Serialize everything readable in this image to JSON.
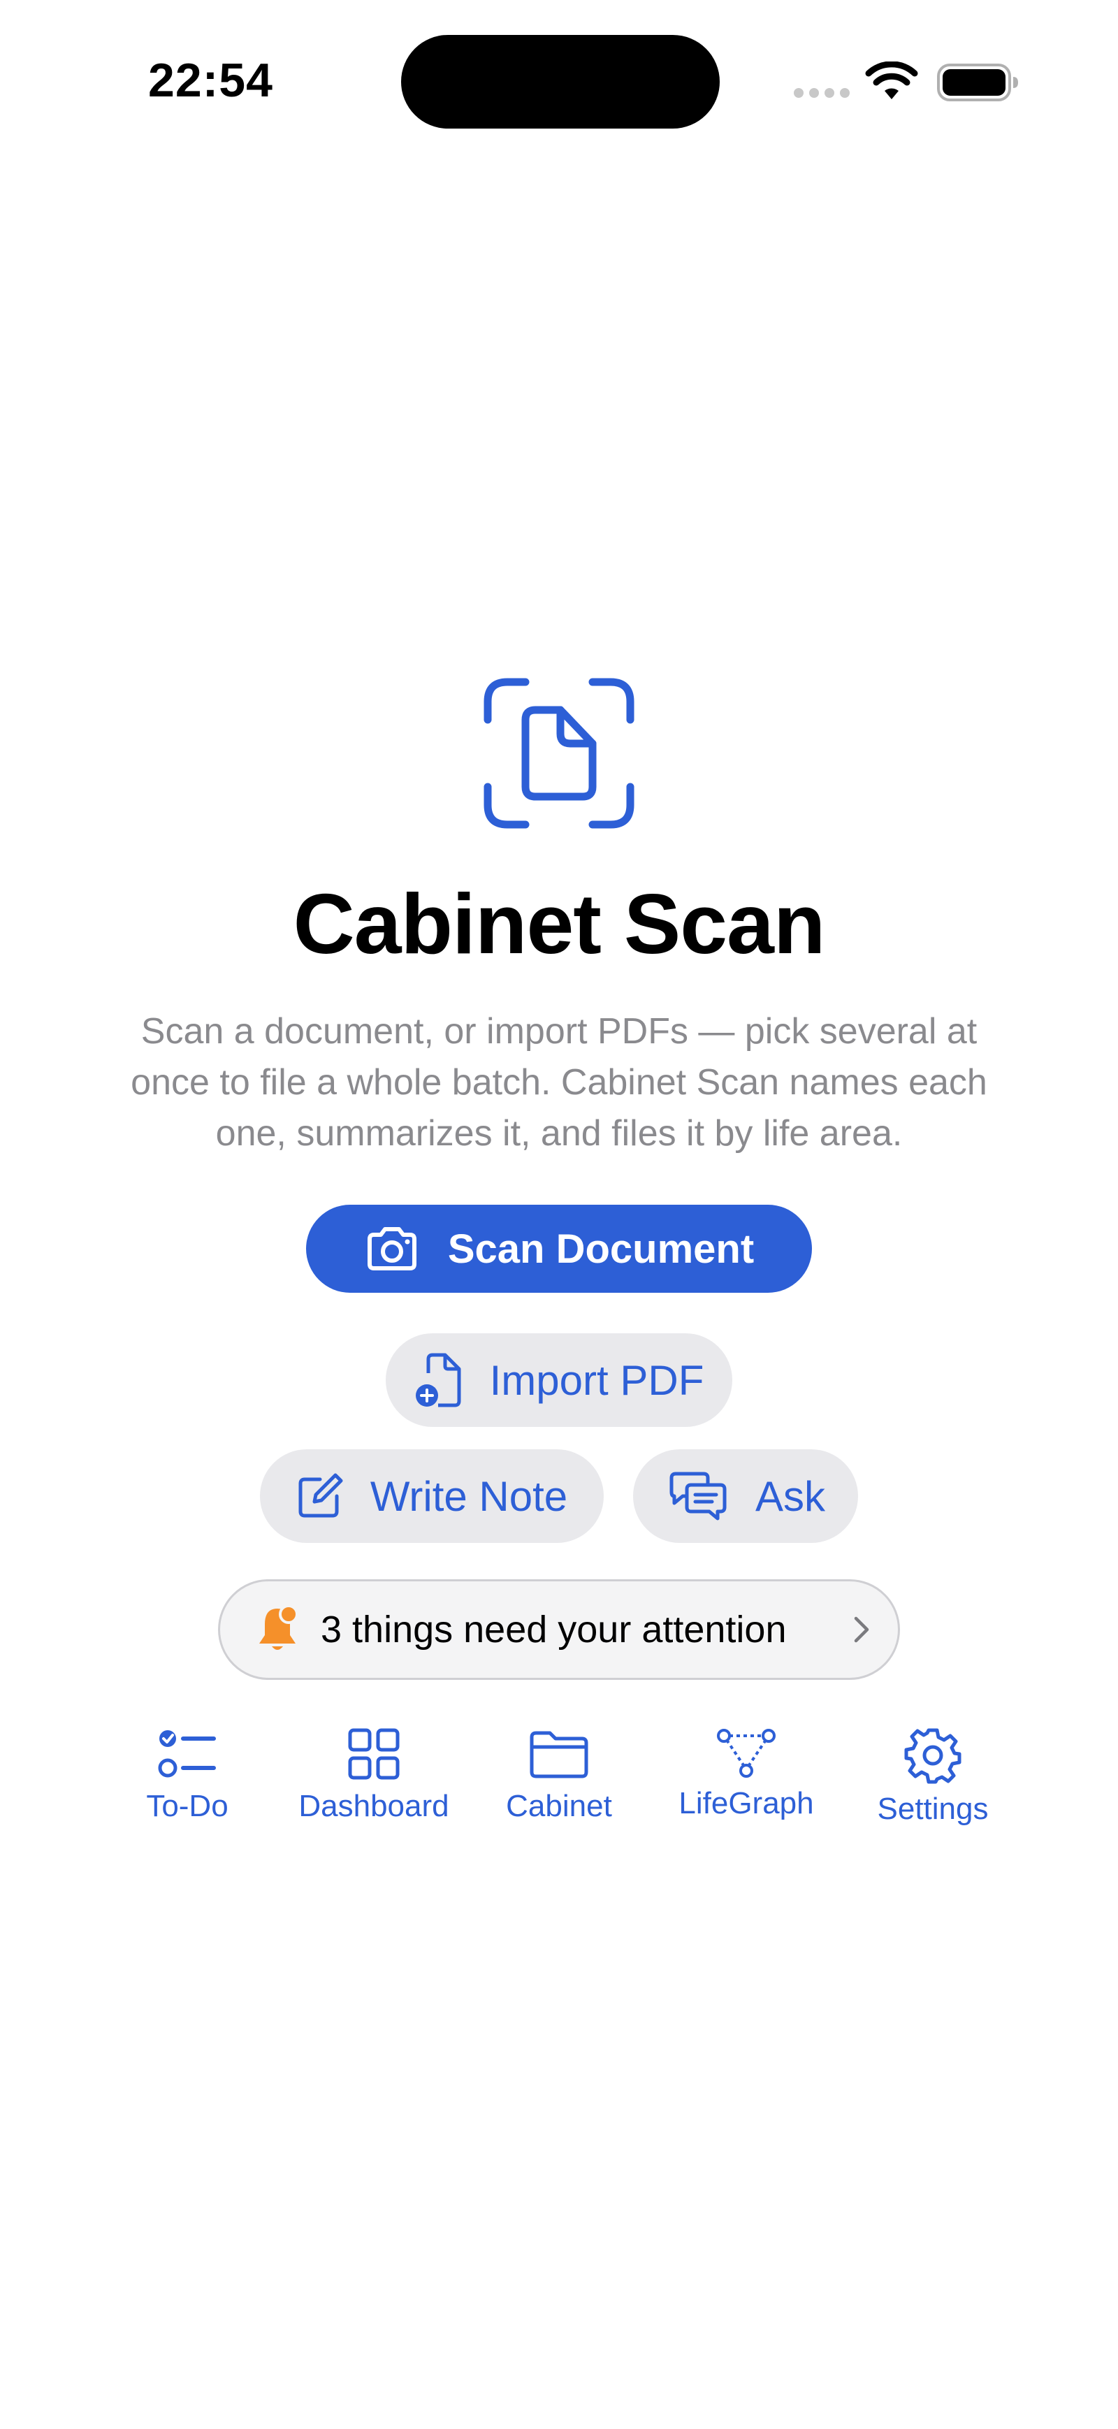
{
  "status_bar": {
    "time": "22:54"
  },
  "colors": {
    "accent": "#2d5fd6",
    "secondary_button_bg": "#e9e9ec",
    "description_text": "#8a8a8e",
    "bell": "#f5902a"
  },
  "hero": {
    "icon": "document-scan-icon",
    "title": "Cabinet Scan",
    "description": "Scan a document, or import PDFs — pick several at once to file a whole batch. Cabinet Scan names each one, summarizes it, and files it by life area."
  },
  "actions": {
    "scan": {
      "label": "Scan Document",
      "icon": "camera-icon"
    },
    "import": {
      "label": "Import PDF",
      "icon": "doc-plus-icon"
    },
    "note": {
      "label": "Write Note",
      "icon": "compose-icon"
    },
    "ask": {
      "label": "Ask",
      "icon": "chat-bubbles-icon"
    }
  },
  "attention": {
    "label": "3 things need your attention",
    "icon": "bell-badge-icon"
  },
  "nav": {
    "items": [
      {
        "label": "To-Do",
        "icon": "checklist-icon"
      },
      {
        "label": "Dashboard",
        "icon": "grid-icon"
      },
      {
        "label": "Cabinet",
        "icon": "folder-icon"
      },
      {
        "label": "LifeGraph",
        "icon": "graph-icon"
      },
      {
        "label": "Settings",
        "icon": "gear-icon"
      }
    ]
  }
}
